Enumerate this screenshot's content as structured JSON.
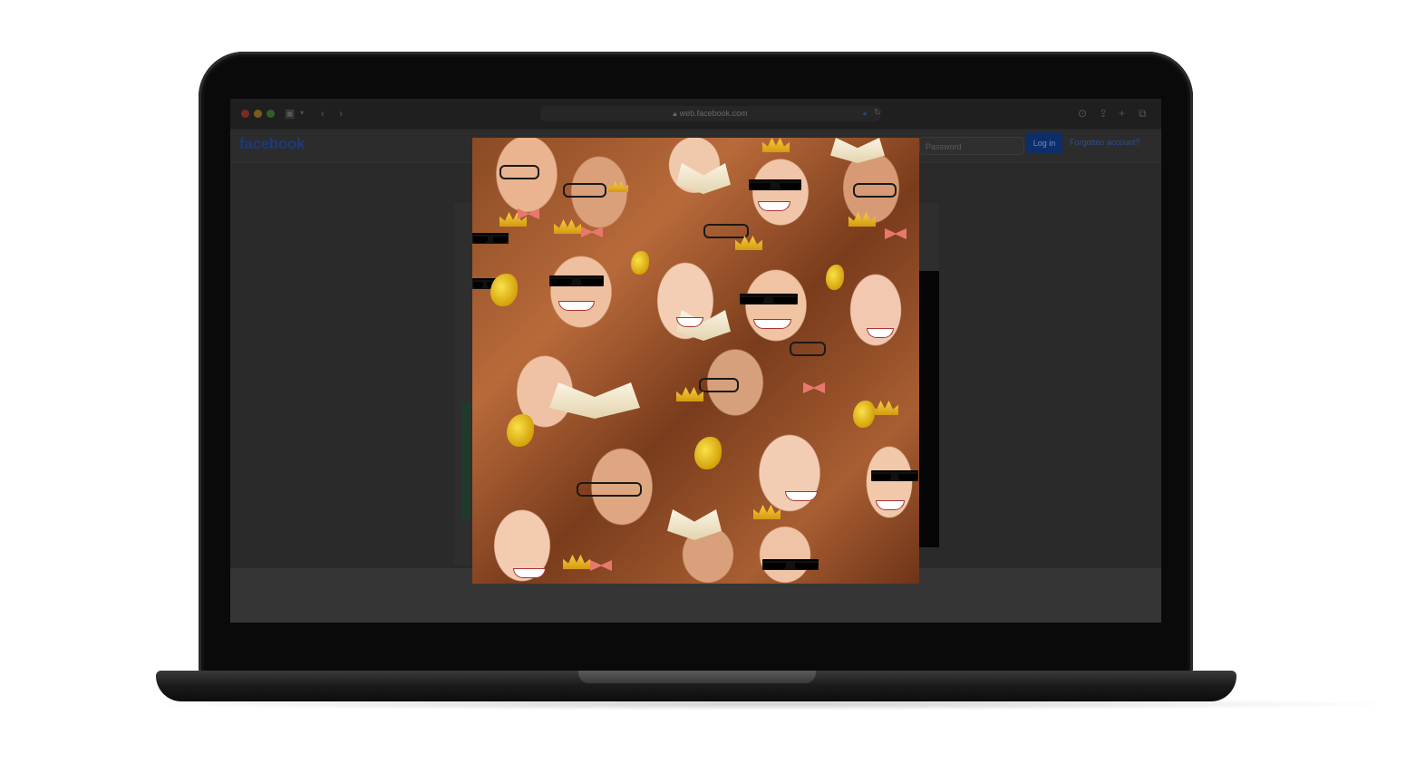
{
  "browser": {
    "url": "web.facebook.com"
  },
  "facebook": {
    "logo": "facebook",
    "password_placeholder": "Password",
    "login_label": "Log in",
    "forgot_label": "Forgotten account?"
  },
  "photo": {
    "icons": [
      "sunglasses-icon",
      "glasses-icon",
      "crown-icon",
      "butterfly-icon",
      "book-icon",
      "bow-icon"
    ]
  }
}
